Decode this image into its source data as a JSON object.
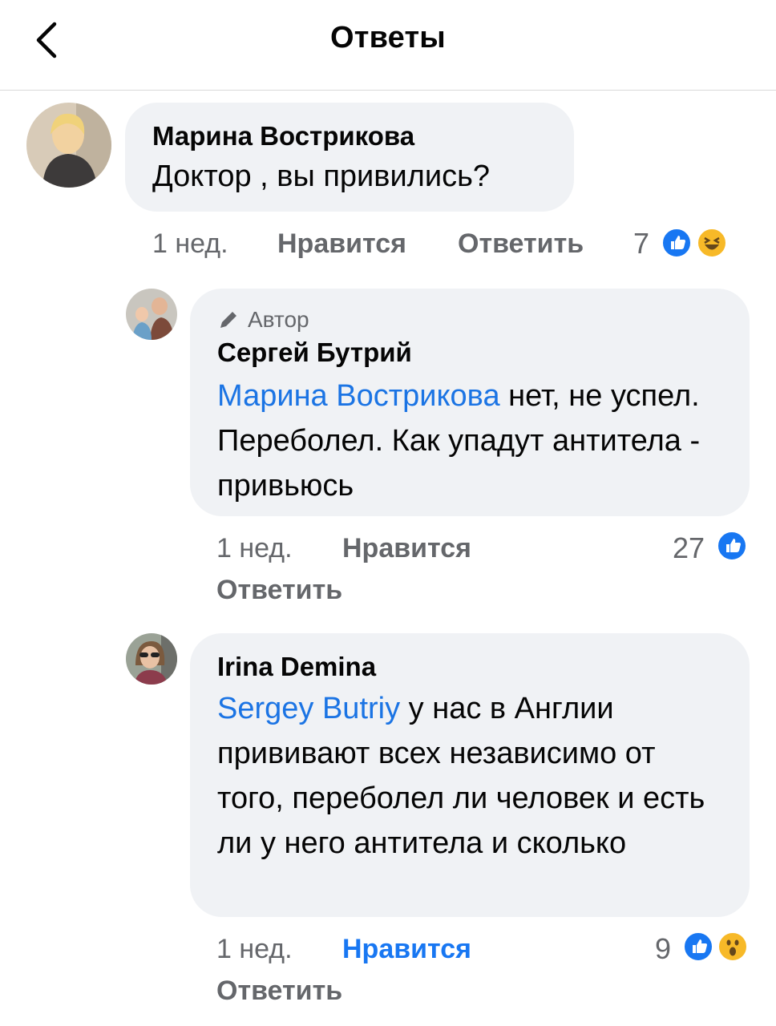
{
  "header": {
    "title": "Ответы"
  },
  "comments": [
    {
      "author": "Марина Вострикова",
      "text": "Доктор , вы привились?",
      "time": "1 нед.",
      "like_label": "Нравится",
      "reply_label": "Ответить",
      "reaction_count": "7",
      "reactions": [
        "like-icon",
        "haha-icon"
      ]
    },
    {
      "badge": "Автор",
      "author": "Сергей Бутрий",
      "mention": "Марина Вострикова",
      "text": " нет, не успел. Переболел. Как упадут антитела - привьюсь",
      "time": "1 нед.",
      "like_label": "Нравится",
      "reply_label": "Ответить",
      "reaction_count": "27",
      "reactions": [
        "like-icon"
      ]
    },
    {
      "author": "Irina Demina",
      "mention": "Sergey Butriy",
      "text": " у нас в Англии прививают всех независимо от того, переболел ли человек и есть ли у него антитела и сколько",
      "time": "1 нед.",
      "like_label": "Нравится",
      "reply_label": "Ответить",
      "reaction_count": "9",
      "reactions": [
        "like-icon",
        "wow-icon"
      ]
    }
  ],
  "colors": {
    "accent": "#1877f2",
    "mention": "#1b74e4",
    "bubble": "#f0f2f5",
    "meta": "#65676b"
  }
}
